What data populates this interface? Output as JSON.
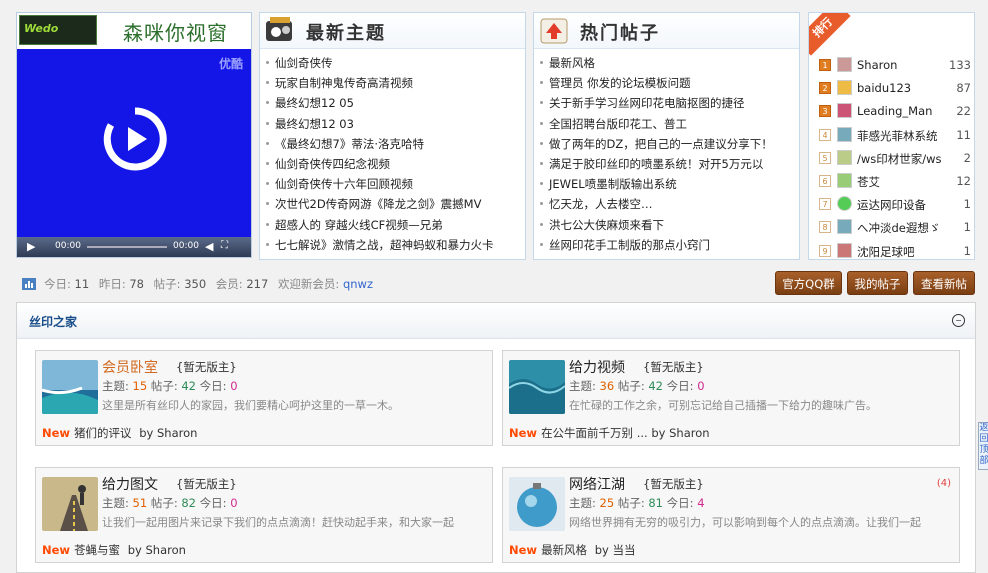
{
  "video": {
    "logo_text": "Wedo",
    "title": "森咪你视窗",
    "brand": "优酷",
    "time_current": "00:00",
    "time_total": "00:00"
  },
  "latest": {
    "title": "最新主题",
    "items": [
      "仙剑奇侠传",
      "玩家自制神鬼传奇高清视频",
      "最终幻想12 05",
      "最终幻想12 03",
      "《最终幻想7》蒂法·洛克哈特",
      "仙剑奇侠传四纪念视频",
      "仙剑奇侠传十六年回顾视频",
      "次世代2D传奇网游《降龙之剑》震撼MV",
      "超感人的 穿越火线CF视频—兄弟",
      "七七解说》激情之战，超神蚂蚁和暴力火卡"
    ]
  },
  "hot": {
    "title": "热门帖子",
    "items": [
      "最新风格",
      "管理员 你发的论坛模板问题",
      "关于新手学习丝网印花电脑抠图的捷径",
      "全国招聘台版印花工、普工",
      "做了两年的DZ，把自己的一点建议分享下！",
      "满足于胶印丝印的喷墨系统！对开5万元以",
      "JEWEL喷墨制版输出系统",
      "忆天龙，人去楼空…",
      "洪七公大侠麻烦来看下",
      "丝网印花手工制版的那点小窍门"
    ]
  },
  "rank": {
    "ribbon": "排行",
    "items": [
      {
        "num": "1",
        "name": "Sharon",
        "count": "133"
      },
      {
        "num": "2",
        "name": "baidu123",
        "count": "87"
      },
      {
        "num": "3",
        "name": "Leading_Man",
        "count": "22"
      },
      {
        "num": "4",
        "name": "菲感光菲林系统",
        "count": "11"
      },
      {
        "num": "5",
        "name": "/ws印材世家/ws",
        "count": "2"
      },
      {
        "num": "6",
        "name": "苍艾",
        "count": "12"
      },
      {
        "num": "7",
        "name": "运达网印设备",
        "count": "1"
      },
      {
        "num": "8",
        "name": "へ冲淡de遐想ゞ",
        "count": "1"
      },
      {
        "num": "9",
        "name": "沈阳足球吧",
        "count": "1"
      }
    ]
  },
  "stats": {
    "today_label": "今日:",
    "today": "11",
    "yesterday_label": "昨日:",
    "yesterday": "78",
    "posts_label": "帖子:",
    "posts": "350",
    "members_label": "会员:",
    "members": "217",
    "welcome_label": "欢迎新会员:",
    "new_member": "qnwz"
  },
  "buttons": {
    "qq": "官方QQ群",
    "my_posts": "我的帖子",
    "new_posts": "查看新帖"
  },
  "forum": {
    "title": "丝印之家",
    "collapse": "−",
    "boards": [
      {
        "name": "会员卧室",
        "mod": "{暂无版主}",
        "topics_label": "主题:",
        "topics": "15",
        "posts_label": "帖子:",
        "posts": "42",
        "today_label": "今日:",
        "today": "0",
        "desc": "这里是所有丝印人的家园，我们要精心呵护这里的一草一木。",
        "new": "New",
        "last": "猪们的评议",
        "by": "by Sharon",
        "badge": ""
      },
      {
        "name": "给力视频",
        "mod": "{暂无版主}",
        "topics_label": "主题:",
        "topics": "36",
        "posts_label": "帖子:",
        "posts": "42",
        "today_label": "今日:",
        "today": "0",
        "desc": "在忙碌的工作之余，可别忘记给自己插播一下给力的趣味广告。",
        "new": "New",
        "last": "在公牛面前千万别 ...",
        "by": "by Sharon",
        "badge": ""
      },
      {
        "name": "给力图文",
        "mod": "{暂无版主}",
        "topics_label": "主题:",
        "topics": "51",
        "posts_label": "帖子:",
        "posts": "82",
        "today_label": "今日:",
        "today": "0",
        "desc": "让我们一起用图片来记录下我们的点点滴滴！赶快动起手来，和大家一起",
        "new": "New",
        "last": "苍蝇与蜜",
        "by": "by Sharon",
        "badge": ""
      },
      {
        "name": "网络江湖",
        "mod": "{暂无版主}",
        "topics_label": "主题:",
        "topics": "25",
        "posts_label": "帖子:",
        "posts": "81",
        "today_label": "今日:",
        "today": "4",
        "desc": "网络世界拥有无穷的吸引力，可以影响到每个人的点点滴滴。让我们一起",
        "new": "New",
        "last": "最新风格",
        "by": "by 当当",
        "badge": "(4)"
      }
    ]
  },
  "floattab": "返回顶部"
}
